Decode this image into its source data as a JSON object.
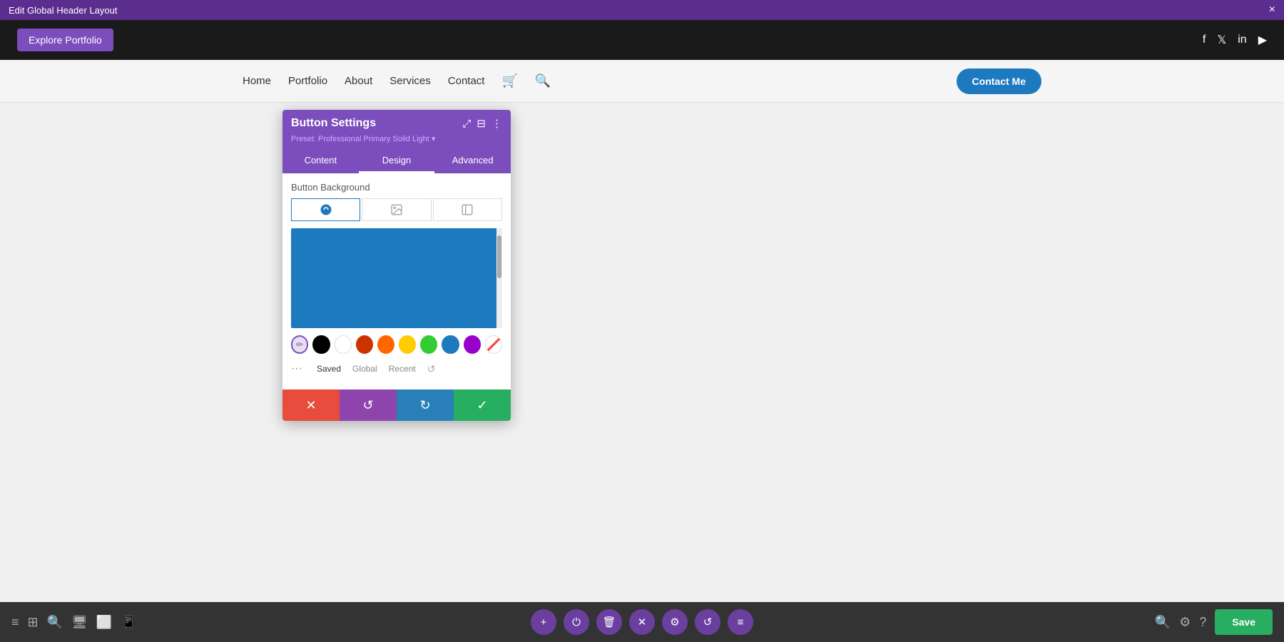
{
  "topBar": {
    "title": "Edit Global Header Layout",
    "closeLabel": "×"
  },
  "header": {
    "exploreBtn": "Explore Portfolio",
    "socialIcons": [
      "f",
      "𝕏",
      "in",
      "▶"
    ]
  },
  "nav": {
    "links": [
      "Home",
      "Portfolio",
      "About",
      "Services",
      "Contact"
    ],
    "contactBtn": "Contact Me"
  },
  "panel": {
    "title": "Button Settings",
    "preset": "Preset: Professional Primary Solid Light ▾",
    "tabs": [
      "Content",
      "Design",
      "Advanced"
    ],
    "activeTab": "Design",
    "bgLabel": "Button Background",
    "bgTypes": [
      "🎨",
      "🖼",
      "🖼"
    ],
    "savedTabs": [
      "Saved",
      "Global",
      "Recent"
    ],
    "colors": [
      "#000000",
      "#ffffff",
      "#cc3300",
      "#ff6600",
      "#ffcc00",
      "#33cc33",
      "#1e7abf",
      "#9900cc"
    ],
    "actionButtons": {
      "cancel": "✕",
      "undo": "↺",
      "redo": "↻",
      "confirm": "✓"
    }
  },
  "bottomToolbar": {
    "leftIcons": [
      "≡",
      "⊞",
      "🔍",
      "□",
      "▭",
      "📱"
    ],
    "centerIcons": [
      "+",
      "⏻",
      "🗑",
      "✕",
      "⚙",
      "↺",
      "≡"
    ],
    "saveLabel": "Save",
    "rightIcons": [
      "🔍",
      "⚙",
      "?"
    ]
  }
}
